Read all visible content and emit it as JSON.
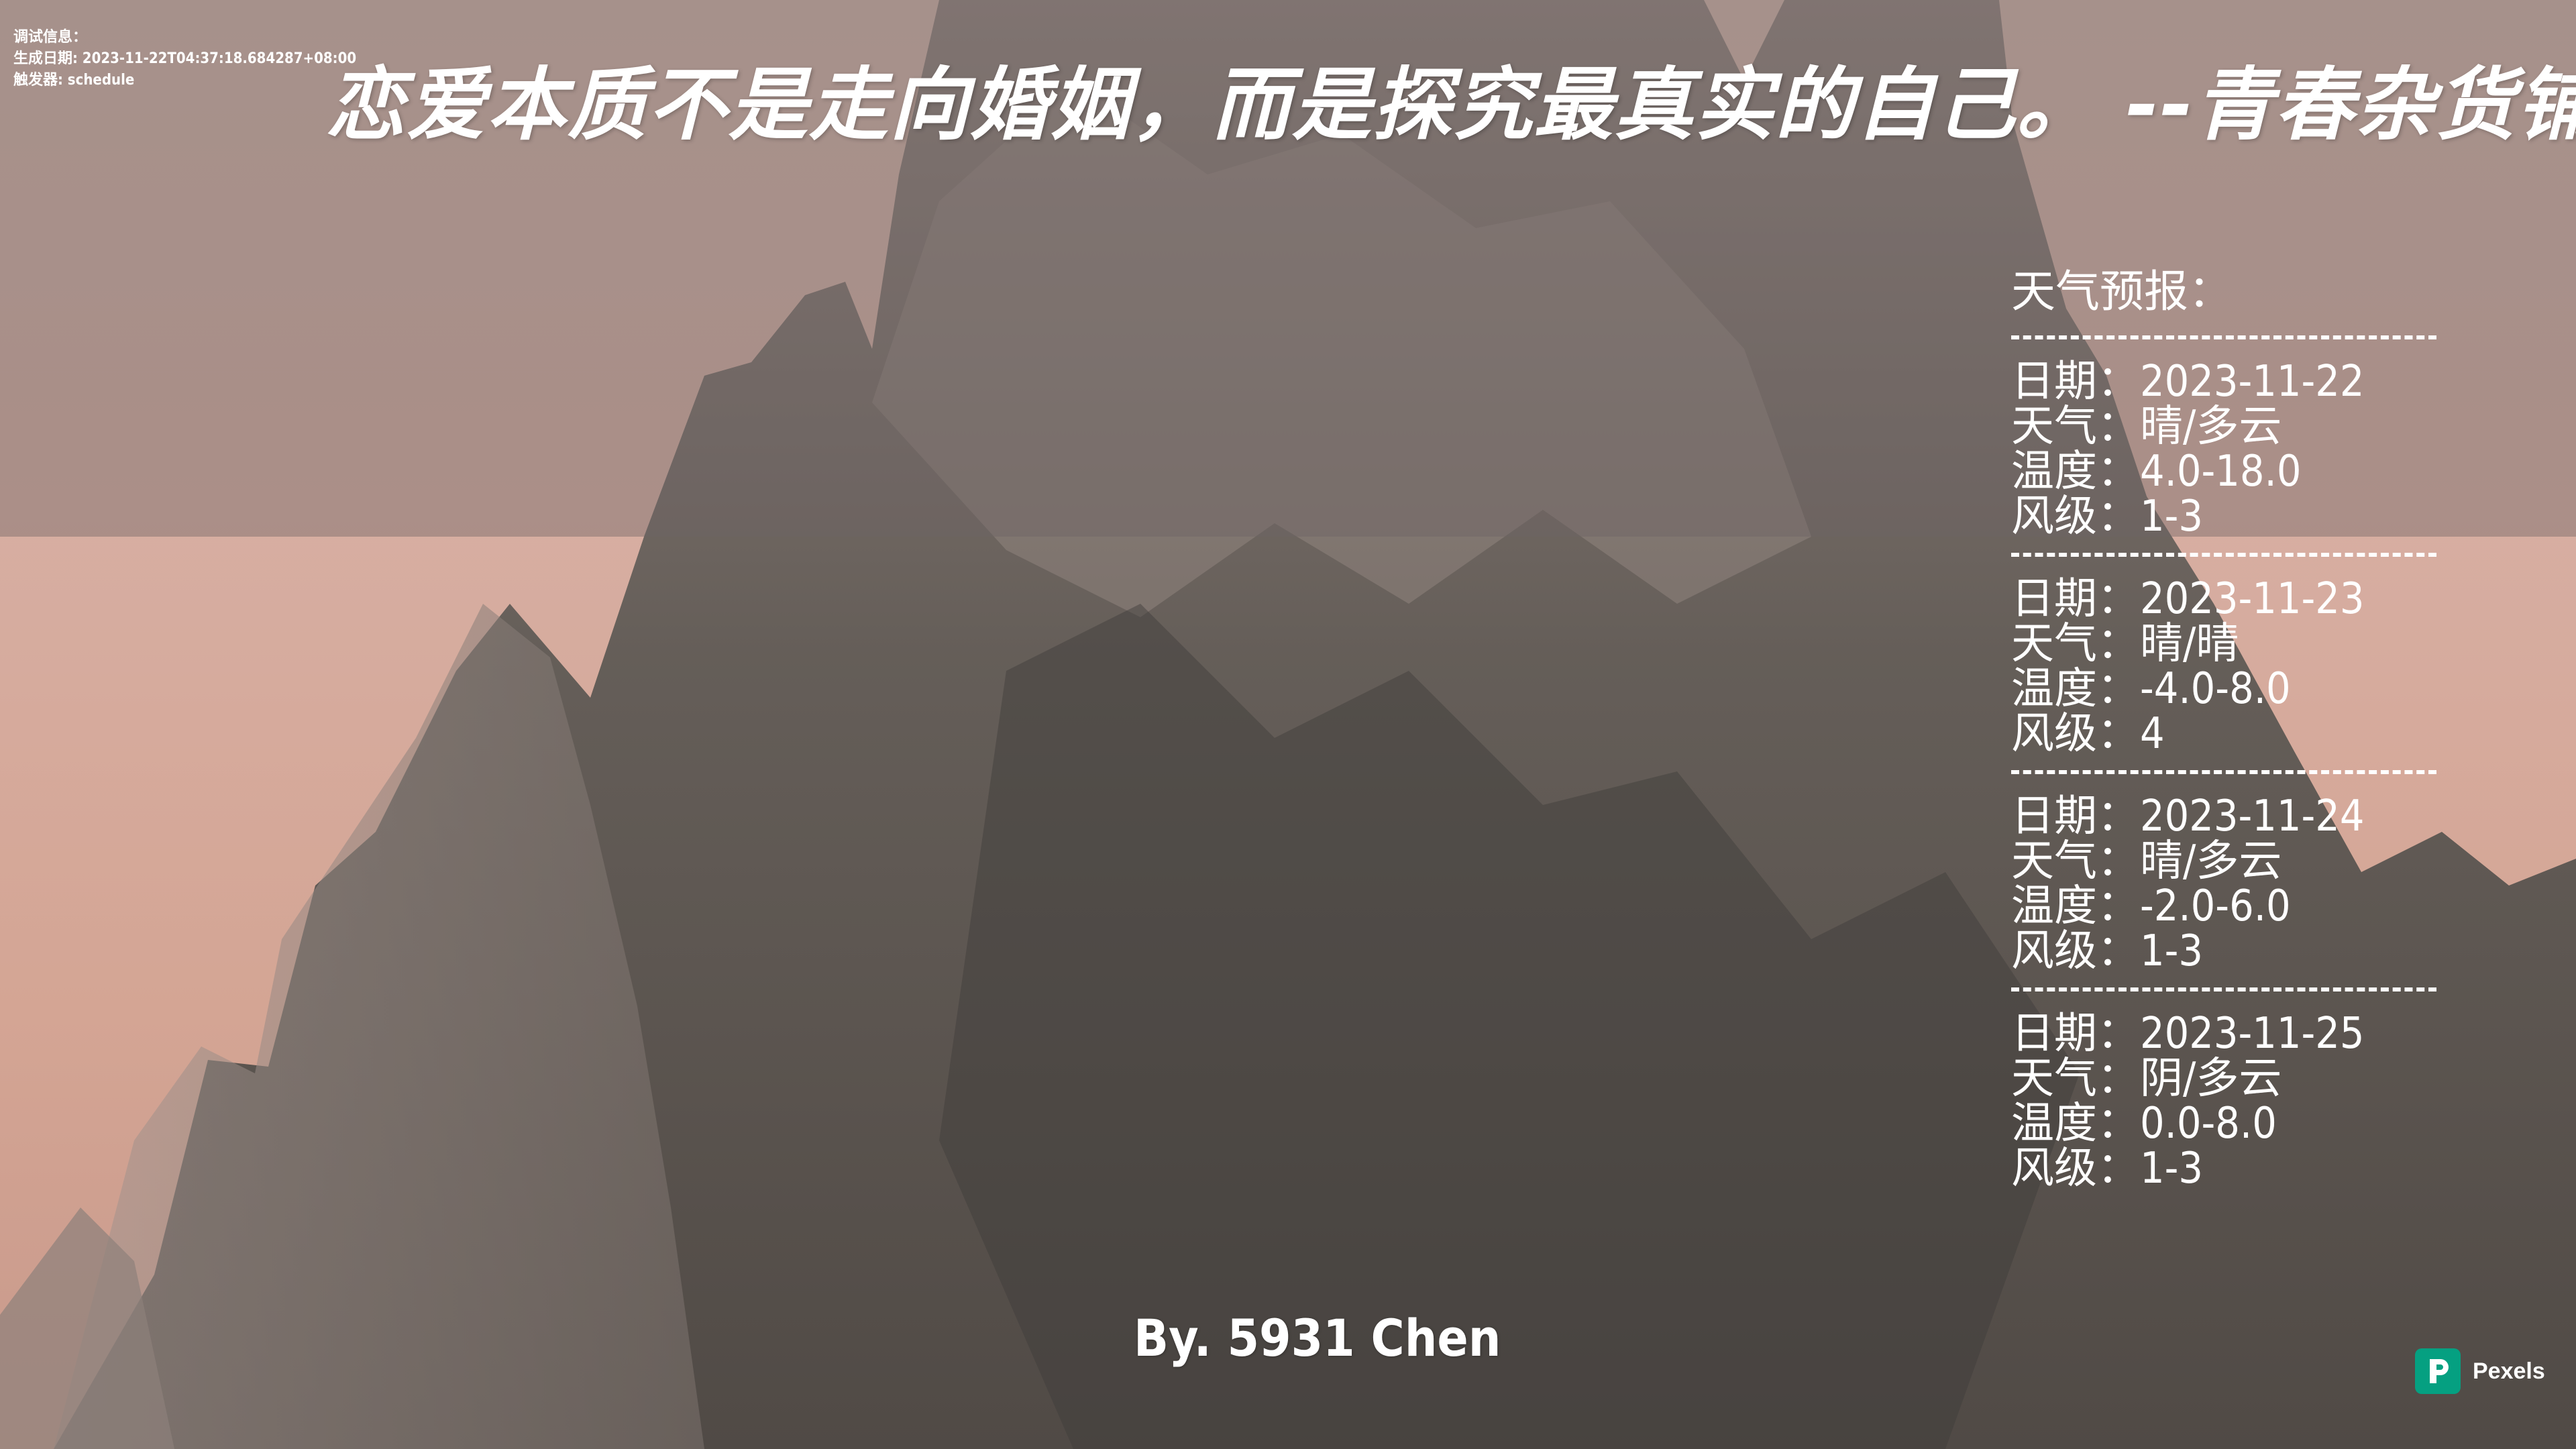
{
  "debug": {
    "line1": "调试信息：",
    "line2": "生成日期: 2023-11-22T04:37:18.684287+08:00",
    "line3": "触发器: schedule"
  },
  "quote": "恋爱本质不是走向婚姻，而是探究最真实的自己。  --青春杂货铺",
  "weather": {
    "title": "天气预报：",
    "days": [
      {
        "date": "日期：2023-11-22",
        "weather": "天气：晴/多云",
        "temp": "温度：4.0-18.0",
        "wind": "风级：1-3"
      },
      {
        "date": "日期：2023-11-23",
        "weather": "天气：晴/晴",
        "temp": "温度：-4.0-8.0",
        "wind": "风级：4"
      },
      {
        "date": "日期：2023-11-24",
        "weather": "天气：晴/多云",
        "temp": "温度：-2.0-6.0",
        "wind": "风级：1-3"
      },
      {
        "date": "日期：2023-11-25",
        "weather": "天气：阴/多云",
        "temp": "温度：0.0-8.0",
        "wind": "风级：1-3"
      }
    ]
  },
  "credit": "By. 5931 Chen",
  "watermark": {
    "name": "Pexels",
    "icon": "pexels-logo-icon",
    "color": "#05a081"
  }
}
